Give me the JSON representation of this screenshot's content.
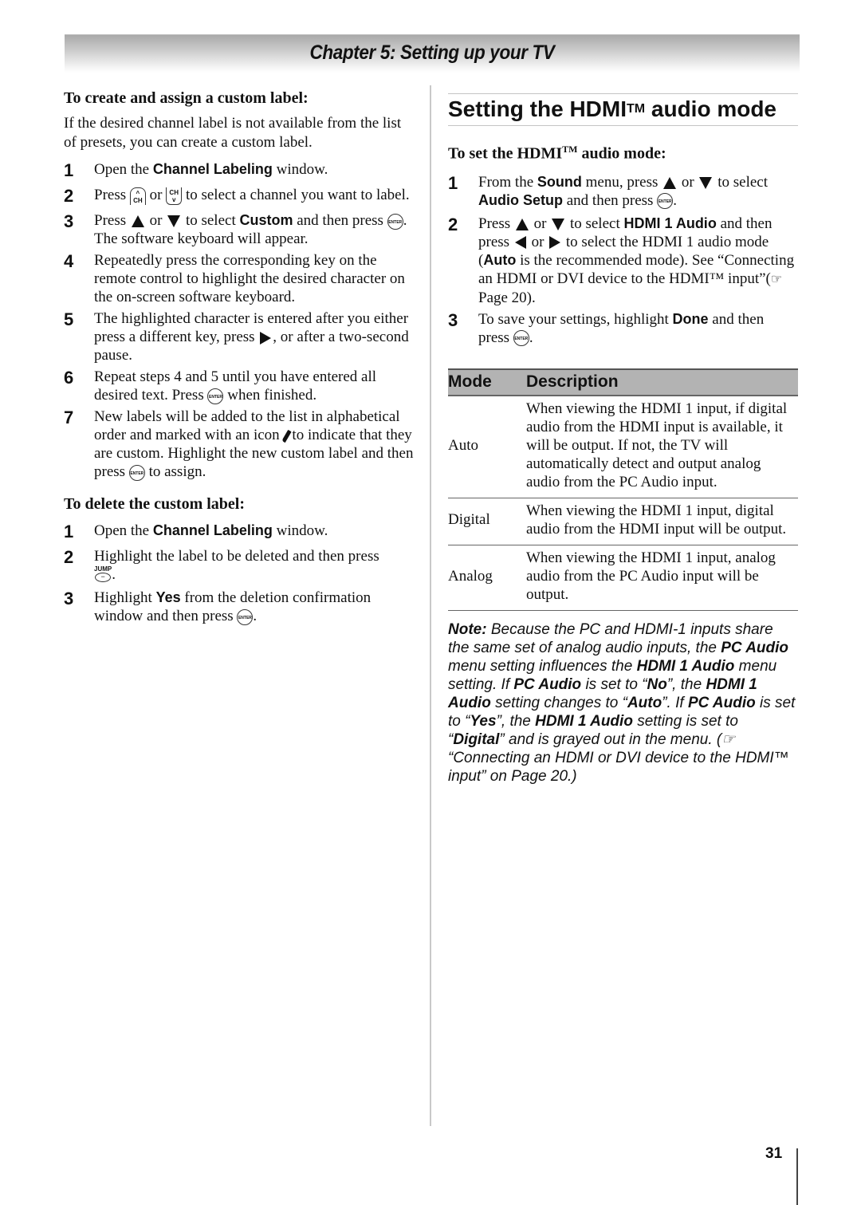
{
  "header": {
    "chapter_title": "Chapter 5: Setting up your TV"
  },
  "left": {
    "create_heading": "To create and assign a custom label:",
    "create_intro": "If the desired channel label is not available from the list of presets, you can create a custom label.",
    "create_steps": [
      {
        "num": "1",
        "t1": "Open the ",
        "b1": "Channel Labeling",
        "t2": " window."
      },
      {
        "num": "2",
        "t1": "Press ",
        "t2": " or ",
        "t3": " to select a channel you want to label."
      },
      {
        "num": "3",
        "t1": "Press ",
        "t2": " or ",
        "t3": " to select ",
        "b1": "Custom",
        "t4": " and then press ",
        "t5": ".",
        "t6": "The software keyboard will appear."
      },
      {
        "num": "4",
        "t1": "Repeatedly press the corresponding key on the remote control to highlight the desired character on the on-screen software keyboard."
      },
      {
        "num": "5",
        "t1": "The highlighted character is entered after you either press a different key, press ",
        "t2": ", or after a two-second pause."
      },
      {
        "num": "6",
        "t1": "Repeat steps 4 and 5 until you have entered all desired text. Press ",
        "t2": " when finished."
      },
      {
        "num": "7",
        "t1": "New labels will be added to the list in alphabetical order and marked with an icon",
        "t2": " to indicate that they are custom. Highlight the new custom label and then press ",
        "t3": " to assign."
      }
    ],
    "delete_heading": "To delete the custom label:",
    "delete_steps": [
      {
        "num": "1",
        "t1": "Open the ",
        "b1": "Channel Labeling",
        "t2": " window."
      },
      {
        "num": "2",
        "t1": "Highlight the label to be deleted and then press",
        "t2": "."
      },
      {
        "num": "3",
        "t1": "Highlight ",
        "b1": "Yes",
        "t2": " from the deletion confirmation window and then press ",
        "t3": "."
      }
    ]
  },
  "buttons": {
    "enter": "ENTER",
    "ch": "CH",
    "jump": "JUMP",
    "jump_symbol": "−"
  },
  "right": {
    "section_title": "Setting the HDMI",
    "section_title_tm": "TM",
    "section_title_end": " audio mode",
    "sub_heading": "To set the HDMI",
    "sub_heading_tm": "TM",
    "sub_heading_end": " audio mode:",
    "steps": [
      {
        "num": "1",
        "t1": "From the ",
        "b1": "Sound",
        "t2": " menu, press ",
        "t3": " or ",
        "t4": " to select ",
        "b2": "Audio Setup",
        "t5": " and then press ",
        "t6": "."
      },
      {
        "num": "2",
        "t1": "Press ",
        "t2": " or ",
        "t3": " to select ",
        "b1": "HDMI 1 Audio",
        "t4": " and then press ",
        "t5": " or ",
        "t6": " to select the HDMI 1 audio mode (",
        "b2": "Auto",
        "t7": " is the recommended mode). See “Connecting an HDMI or DVI device to the HDMI™ input”(",
        "t8": " Page 20)."
      },
      {
        "num": "3",
        "t1": "To save your settings, highlight ",
        "b1": "Done",
        "t2": " and then press ",
        "t3": "."
      }
    ],
    "table": {
      "headers": [
        "Mode",
        "Description"
      ],
      "rows": [
        {
          "mode": "Auto",
          "description": "When viewing the HDMI 1 input, if digital audio from the HDMI input is available, it will be output. If not, the TV will automatically detect and output analog audio from the PC Audio input."
        },
        {
          "mode": "Digital",
          "description": "When viewing the HDMI 1 input, digital audio from the HDMI input will be output."
        },
        {
          "mode": "Analog",
          "description": "When viewing the HDMI 1 input, analog audio from the PC Audio input will be output."
        }
      ]
    },
    "note": {
      "label": "Note:",
      "p1": " Because the PC and HDMI-1 inputs share the same set of analog audio inputs, the ",
      "b1": "PC Audio",
      "p2": " menu setting influences the ",
      "b2": "HDMI 1 Audio",
      "p3": " menu setting. If ",
      "b3": "PC Audio",
      "p4": " is set to “",
      "b4": "No",
      "p5": "”, the ",
      "b5": "HDMI 1 Audio",
      "p6": " setting changes to “",
      "b6": "Auto",
      "p7": "”. If ",
      "b7": "PC Audio",
      "p8": " is set to “",
      "b8": "Yes",
      "p9": "”, the ",
      "b9": "HDMI 1 Audio",
      "p10": " setting is set to “",
      "b10": "Digital",
      "p11": "” and is grayed out in the menu. (",
      "p12": " “Connecting an HDMI or DVI device to the HDMI™ input” on Page 20.)"
    }
  },
  "icons": {
    "pointer": "☞"
  },
  "footer": {
    "page_number": "31"
  }
}
